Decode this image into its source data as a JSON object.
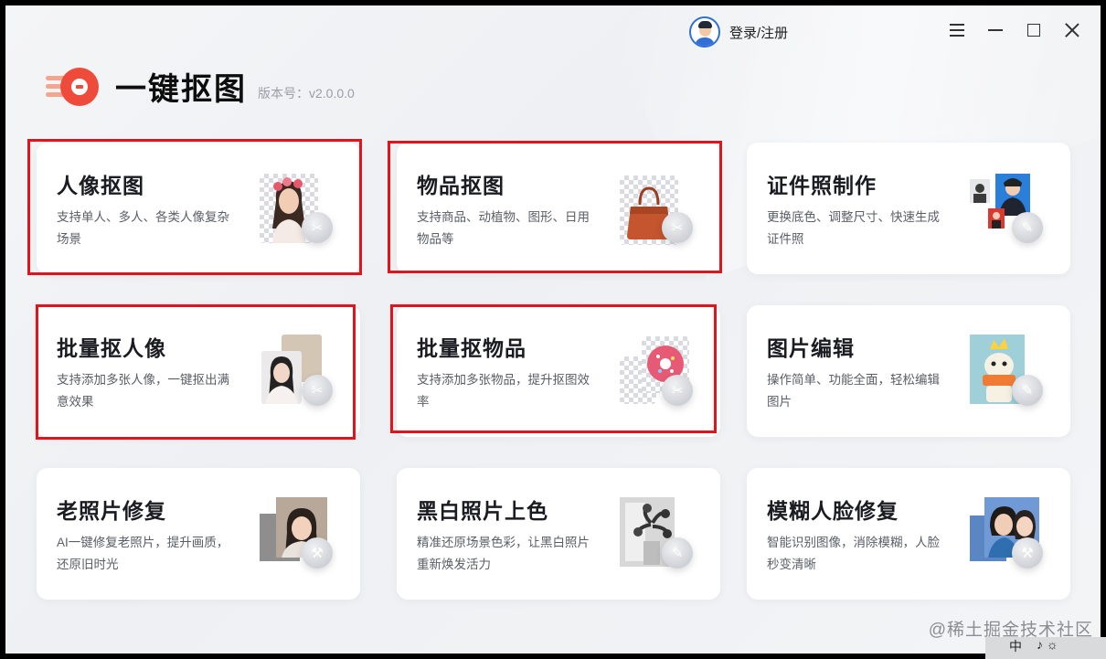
{
  "header": {
    "login_label": "登录/注册",
    "app_title": "一键抠图",
    "version_label": "版本号：v2.0.0.0"
  },
  "window_controls": [
    "menu-icon",
    "minimize-icon",
    "maximize-icon",
    "close-icon"
  ],
  "cards": [
    {
      "title": "人像抠图",
      "desc": "支持单人、多人、各类人像复杂场景",
      "badge": "✂"
    },
    {
      "title": "物品抠图",
      "desc": "支持商品、动植物、图形、日用物品等",
      "badge": "✂"
    },
    {
      "title": "证件照制作",
      "desc": "更换底色、调整尺寸、快速生成证件照",
      "badge": "✎"
    },
    {
      "title": "批量抠人像",
      "desc": "支持添加多张人像，一键抠出满意效果",
      "badge": "✂"
    },
    {
      "title": "批量抠物品",
      "desc": "支持添加多张物品，提升抠图效率",
      "badge": "✂"
    },
    {
      "title": "图片编辑",
      "desc": "操作简单、功能全面，轻松编辑图片",
      "badge": "✎"
    },
    {
      "title": "老照片修复",
      "desc": "AI一键修复老照片，提升画质，还原旧时光",
      "badge": "⚒"
    },
    {
      "title": "黑白照片上色",
      "desc": "精准还原场景色彩，让黑白照片重新焕发活力",
      "badge": "✎"
    },
    {
      "title": "模糊人脸修复",
      "desc": "智能识别图像，消除模糊，人脸秒变清晰",
      "badge": "⚒"
    }
  ],
  "highlighted_cards": [
    "人像抠图",
    "物品抠图",
    "批量抠人像",
    "批量抠物品"
  ],
  "colors": {
    "highlight": "#e3121b",
    "logo": "#ee4b3a",
    "background": "#f1f2f5"
  },
  "watermark": "@稀土掘金技术社区",
  "taskbar": {
    "ime": "中",
    "icons": "♪ ☼"
  }
}
